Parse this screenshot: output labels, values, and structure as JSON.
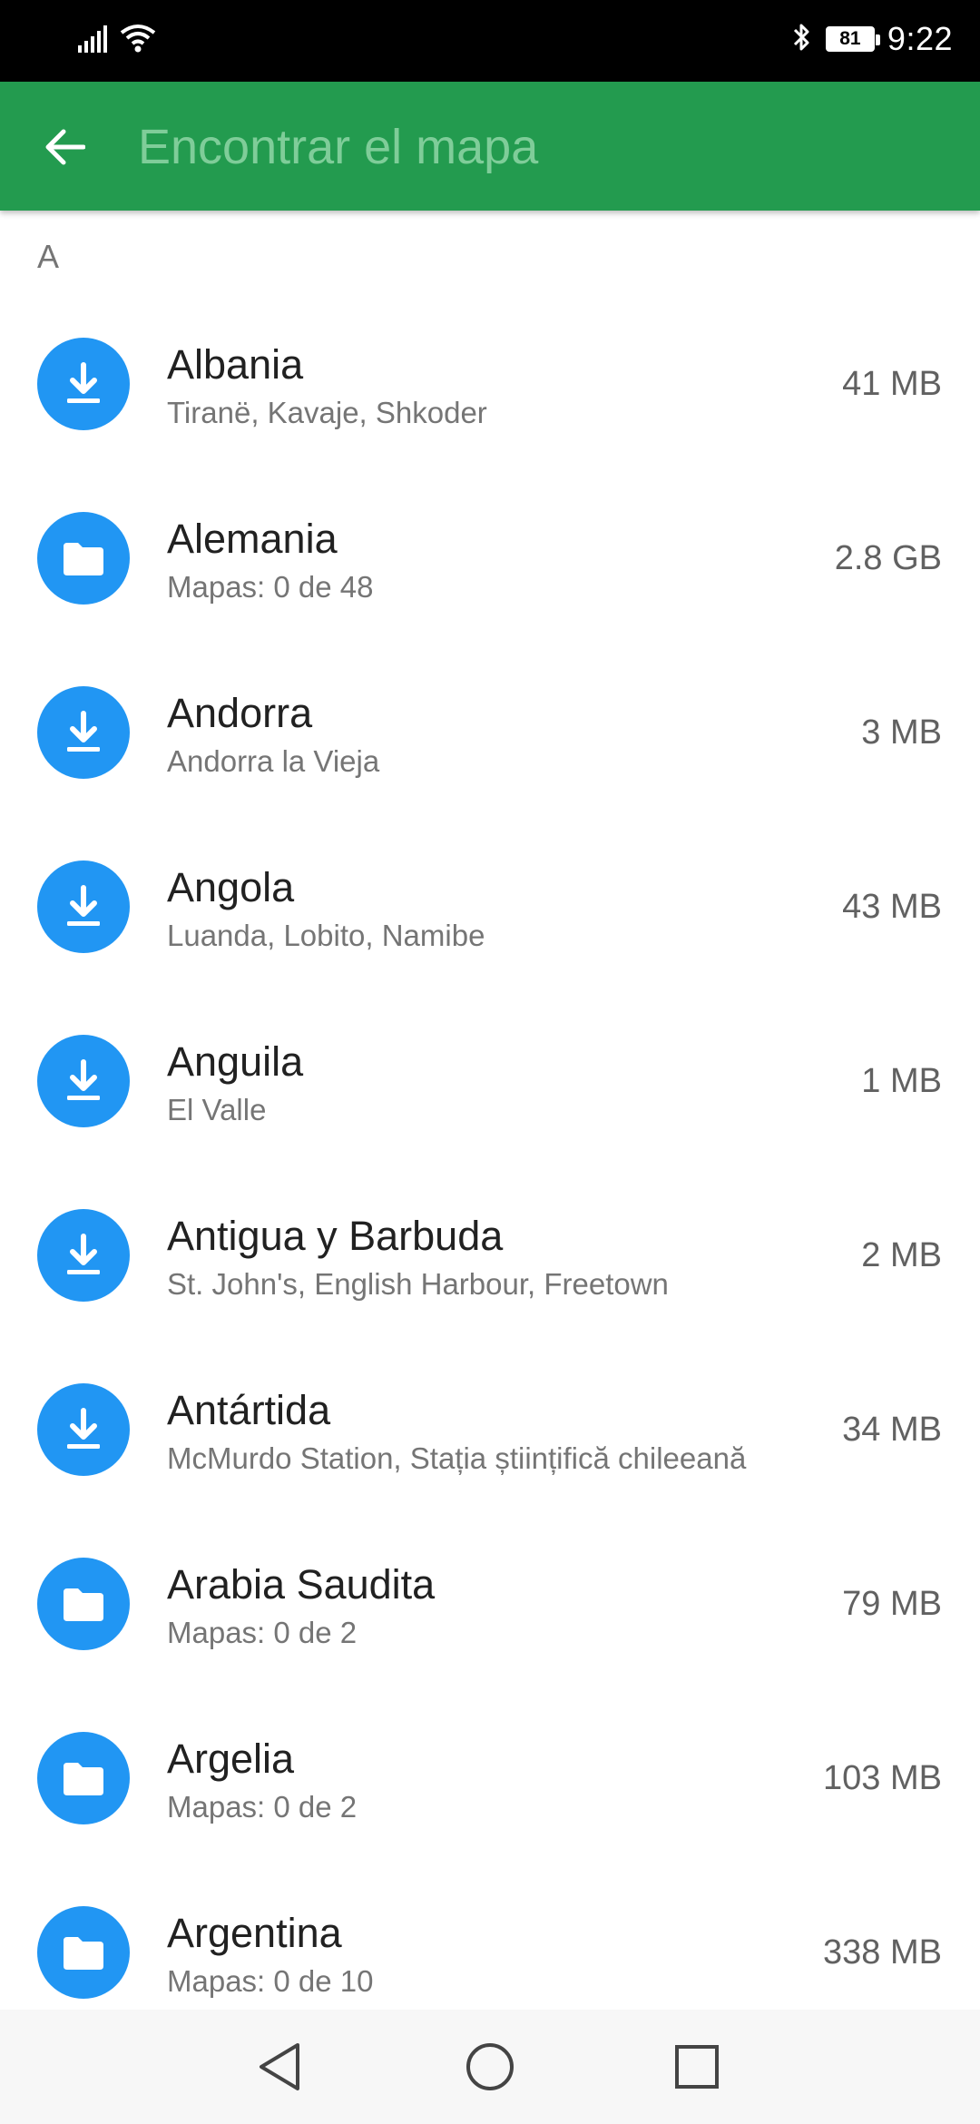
{
  "status_bar": {
    "time": "9:22",
    "battery": "81",
    "icons": [
      "signal-icon",
      "wifi-icon",
      "bluetooth-icon",
      "battery-icon"
    ]
  },
  "app_bar": {
    "search_placeholder": "Encontrar el mapa",
    "search_value": "",
    "back_icon": "back-arrow-icon",
    "background_color": "#239b4f"
  },
  "section": {
    "letter": "A"
  },
  "accent_color": "#2196f3",
  "maps": [
    {
      "name": "Albania",
      "subtitle": "Tiranë, Kavaje, Shkoder",
      "size": "41 MB",
      "icon": "download-icon"
    },
    {
      "name": "Alemania",
      "subtitle": "Mapas: 0 de 48",
      "size": "2.8 GB",
      "icon": "folder-icon"
    },
    {
      "name": "Andorra",
      "subtitle": "Andorra la Vieja",
      "size": "3 MB",
      "icon": "download-icon"
    },
    {
      "name": "Angola",
      "subtitle": "Luanda, Lobito, Namibe",
      "size": "43 MB",
      "icon": "download-icon"
    },
    {
      "name": "Anguila",
      "subtitle": "El Valle",
      "size": "1 MB",
      "icon": "download-icon"
    },
    {
      "name": "Antigua y Barbuda",
      "subtitle": "St. John's, English Harbour, Freetown",
      "size": "2 MB",
      "icon": "download-icon"
    },
    {
      "name": "Antártida",
      "subtitle": "McMurdo Station, Stația științifică chileeană",
      "size": "34 MB",
      "icon": "download-icon"
    },
    {
      "name": "Arabia Saudita",
      "subtitle": "Mapas: 0 de 2",
      "size": "79 MB",
      "icon": "folder-icon"
    },
    {
      "name": "Argelia",
      "subtitle": "Mapas: 0 de 2",
      "size": "103 MB",
      "icon": "folder-icon"
    },
    {
      "name": "Argentina",
      "subtitle": "Mapas: 0 de 10",
      "size": "338 MB",
      "icon": "folder-icon"
    }
  ],
  "nav_bar": {
    "buttons": [
      "back-triangle-icon",
      "home-circle-icon",
      "recents-square-icon"
    ]
  }
}
